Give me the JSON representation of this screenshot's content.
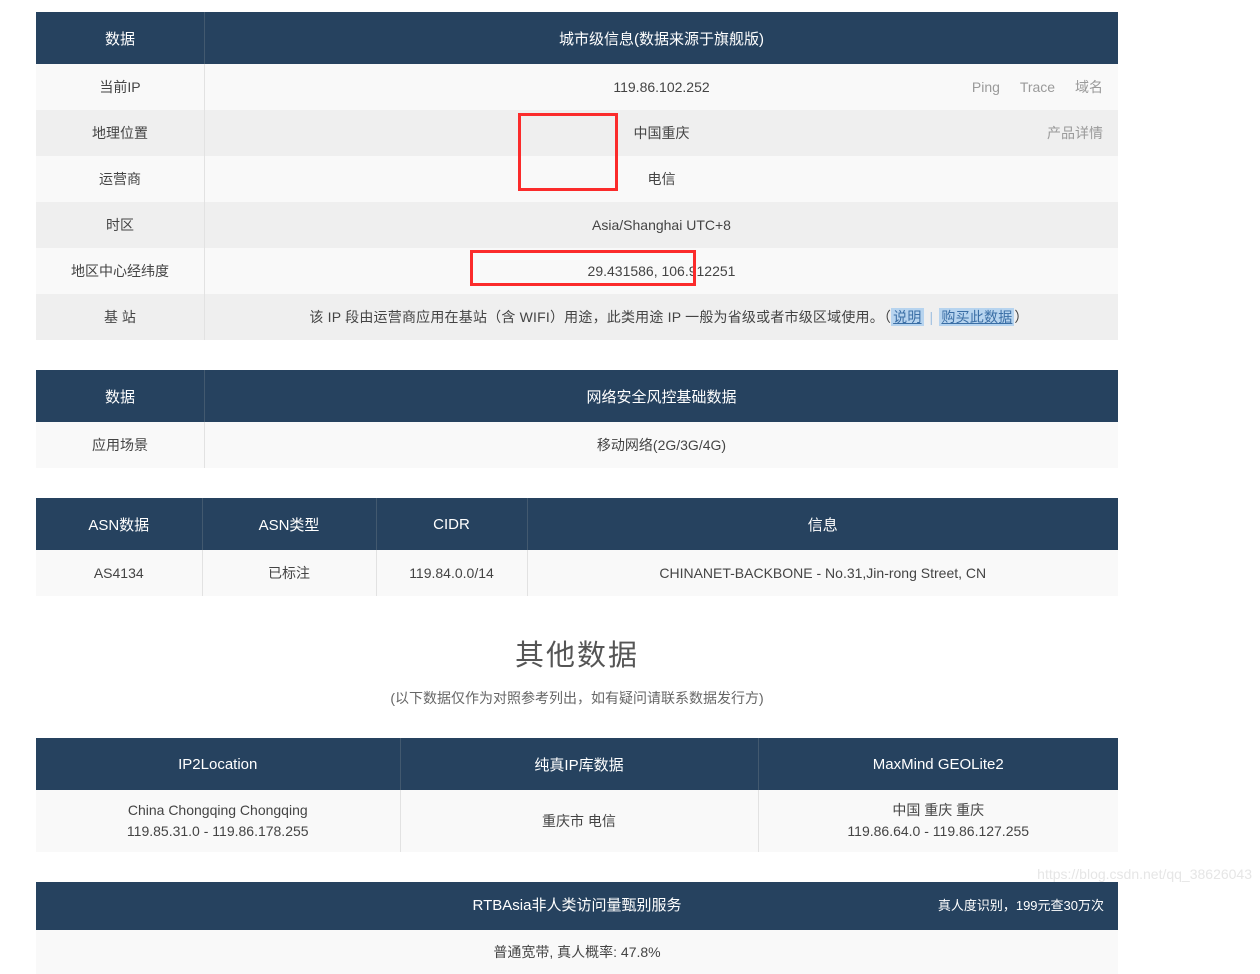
{
  "city_table": {
    "header": {
      "col1": "数据",
      "col2": "城市级信息(数据来源于旗舰版)"
    },
    "rows": [
      {
        "label": "当前IP",
        "value": "119.86.102.252"
      },
      {
        "label": "地理位置",
        "value": "中国重庆"
      },
      {
        "label": "运营商",
        "value": "电信"
      },
      {
        "label": "时区",
        "value": "Asia/Shanghai UTC+8"
      },
      {
        "label": "地区中心经纬度",
        "value": "29.431586, 106.912251"
      },
      {
        "label": "基 站",
        "value": ""
      }
    ],
    "actions_ip": [
      "Ping",
      "Trace",
      "域名"
    ],
    "actions_location": [
      "产品详情"
    ],
    "base_station": {
      "text_before": "该 IP 段由运营商应用在基站（含 WIFI）用途，此类用途 IP 一般为省级或者市级区域使用。（",
      "link1": "说明",
      "divider": "|",
      "link2": "购买此数据",
      "text_after": "）"
    }
  },
  "security_table": {
    "header": {
      "col1": "数据",
      "col2": "网络安全风控基础数据"
    },
    "rows": [
      {
        "label": "应用场景",
        "value": "移动网络(2G/3G/4G)"
      }
    ]
  },
  "asn_table": {
    "headers": [
      "ASN数据",
      "ASN类型",
      "CIDR",
      "信息"
    ],
    "rows": [
      [
        "AS4134",
        "已标注",
        "119.84.0.0/14",
        "CHINANET-BACKBONE - No.31,Jin-rong Street, CN"
      ]
    ]
  },
  "other_section": {
    "title": "其他数据",
    "subtitle": "(以下数据仅作为对照参考列出，如有疑问请联系数据发行方)"
  },
  "other_table": {
    "headers": [
      "IP2Location",
      "纯真IP库数据",
      "MaxMind GEOLite2"
    ],
    "cells": [
      {
        "line1": "China Chongqing Chongqing",
        "line2": "119.85.31.0 - 119.86.178.255"
      },
      {
        "line1": "重庆市 电信",
        "line2": ""
      },
      {
        "line1": "中国 重庆 重庆",
        "line2": "119.86.64.0 - 119.86.127.255"
      }
    ]
  },
  "rtb_section": {
    "title": "RTBAsia非人类访问量甄别服务",
    "right_note": "真人度识别，199元查30万次",
    "body": "普通宽带, 真人概率: 47.8%"
  },
  "watermark": "https://blog.csdn.net/qq_38626043",
  "colors": {
    "header_bg": "#26425f",
    "row_odd": "#f9f9f9",
    "row_even": "#efefef",
    "annotation_red": "#fb2b2b",
    "link_highlight": "#b7d4ef"
  }
}
